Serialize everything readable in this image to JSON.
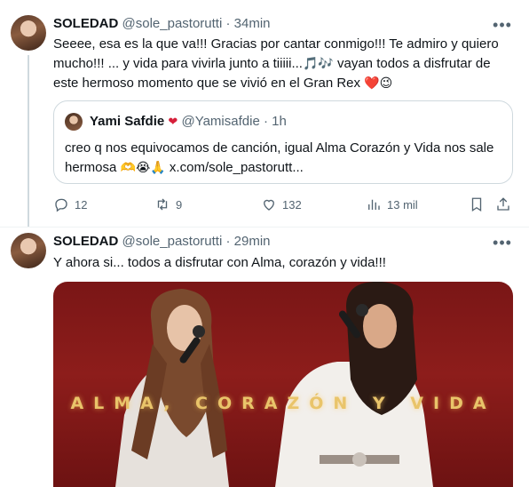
{
  "tweets": [
    {
      "name": "SOLEDAD",
      "handle": "@sole_pastorutti",
      "separator": "·",
      "time": "34min",
      "more": "•••",
      "text": "Seeee,  esa es la que va!!! Gracias por cantar conmigo!!! Te admiro y quiero mucho!!! ... y vida para vivirla junto a tiiiii...",
      "text_emoji": "🎵🎶",
      "text_tail": " vayan todos a disfrutar de este hermoso momento que se vivió en el Gran Rex ",
      "text_end_emoji": "❤️😉",
      "quote": {
        "name": "Yami Safdie",
        "badge": "❤",
        "handle": "@Yamisafdie",
        "separator": "·",
        "time": "1h",
        "text": "creo q nos equivocamos de canción, igual Alma Corazón y Vida nos sale hermosa ",
        "text_emoji": "🫶😭🙏",
        "text_tail": " x.com/sole_pastorutt..."
      },
      "actions": {
        "reply_count": "12",
        "retweet_count": "9",
        "like_count": "132",
        "views_count": "13 mil"
      }
    },
    {
      "name": "SOLEDAD",
      "handle": "@sole_pastorutti",
      "separator": "·",
      "time": "29min",
      "more": "•••",
      "text": "Y ahora si... todos a disfrutar con Alma, corazón y vida!!!",
      "media_caption": "ALMA, CORAZÓN Y VIDA"
    }
  ],
  "colors": {
    "text": "#0f1419",
    "secondary": "#536471",
    "border": "#cfd9de",
    "media_bg": "#7a1616",
    "caption": "#e9c46a"
  },
  "icons": [
    "more-icon",
    "reply-icon",
    "retweet-icon",
    "like-icon",
    "views-icon",
    "bookmark-icon",
    "share-icon"
  ]
}
